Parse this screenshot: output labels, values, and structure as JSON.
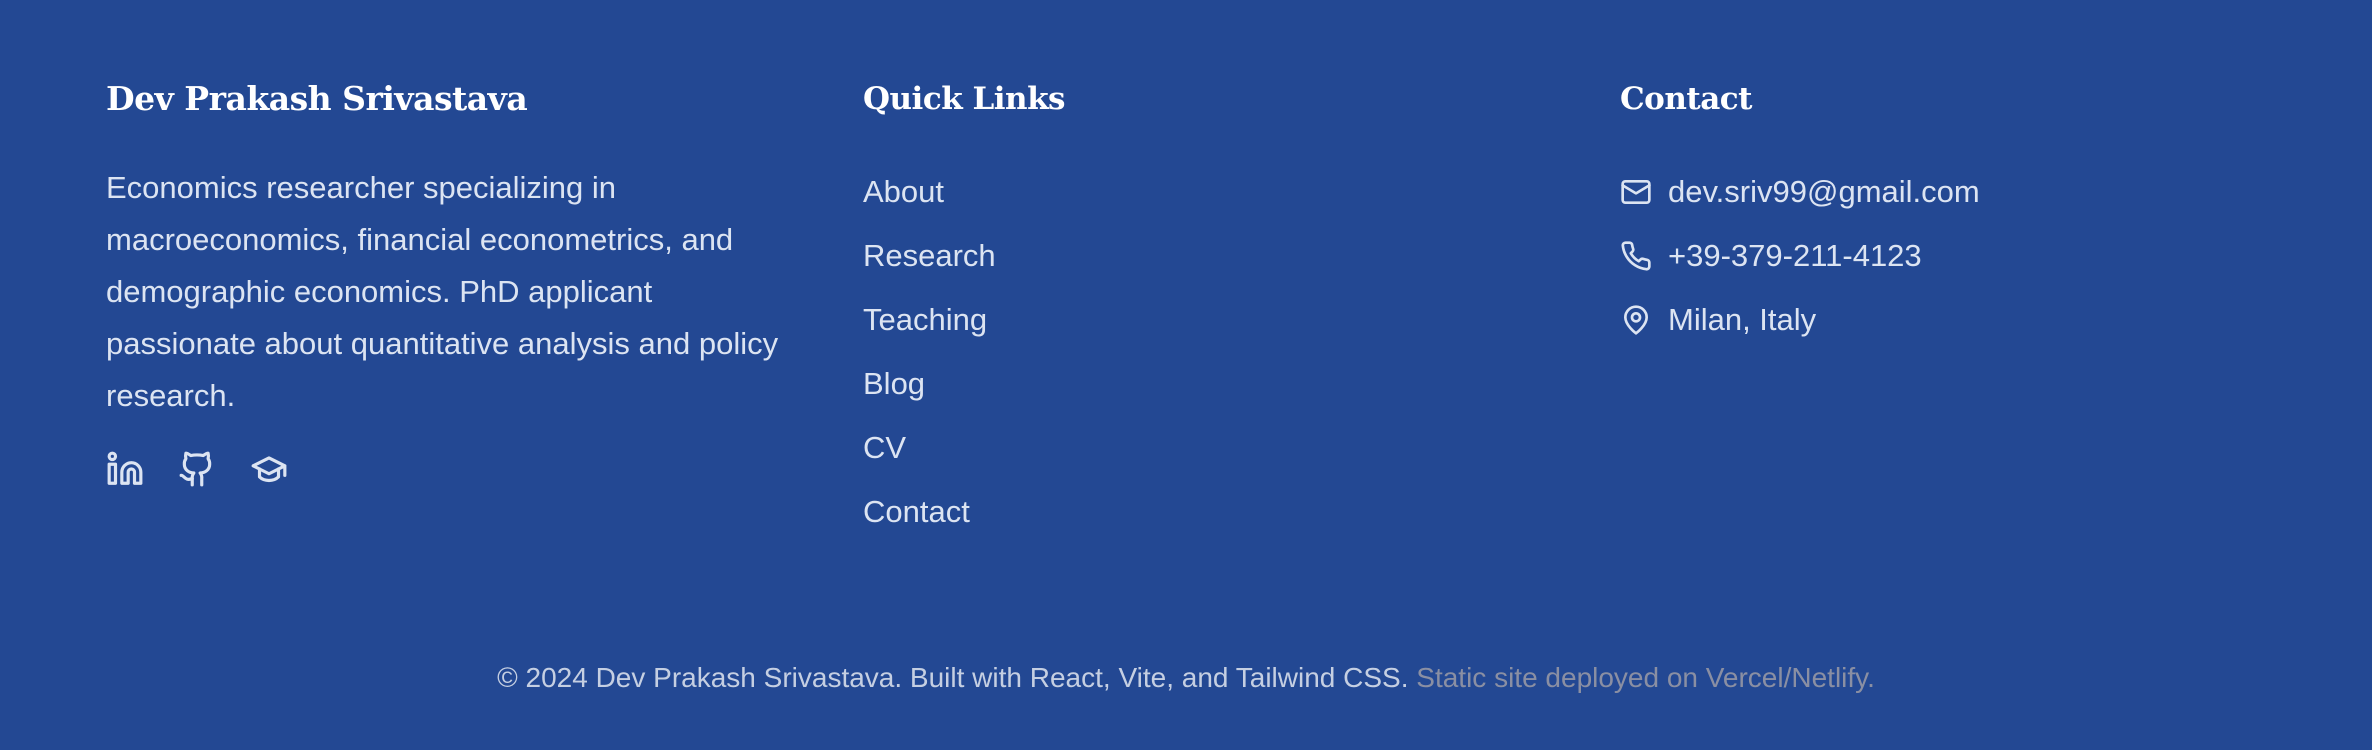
{
  "about": {
    "name": "Dev Prakash Srivastava",
    "bio": "Economics researcher specializing in macroeconomics, financial econometrics, and demographic economics. PhD applicant passionate about quantitative analysis and policy research.",
    "social": [
      {
        "icon": "linkedin-icon"
      },
      {
        "icon": "github-icon"
      },
      {
        "icon": "graduation-cap-icon"
      }
    ]
  },
  "quick_links": {
    "heading": "Quick Links",
    "items": [
      "About",
      "Research",
      "Teaching",
      "Blog",
      "CV",
      "Contact"
    ]
  },
  "contact": {
    "heading": "Contact",
    "email": "dev.sriv99@gmail.com",
    "phone": "+39-379-211-4123",
    "location": "Milan, Italy"
  },
  "footer": {
    "copyright": "© 2024 Dev Prakash Srivastava. Built with React, Vite, and Tailwind CSS.",
    "deploy_note": "Static site deployed on Vercel/Netlify."
  },
  "colors": {
    "background": "#234893",
    "text": "#dce4f2",
    "heading": "#ffffff",
    "muted": "#8a8fa3"
  }
}
